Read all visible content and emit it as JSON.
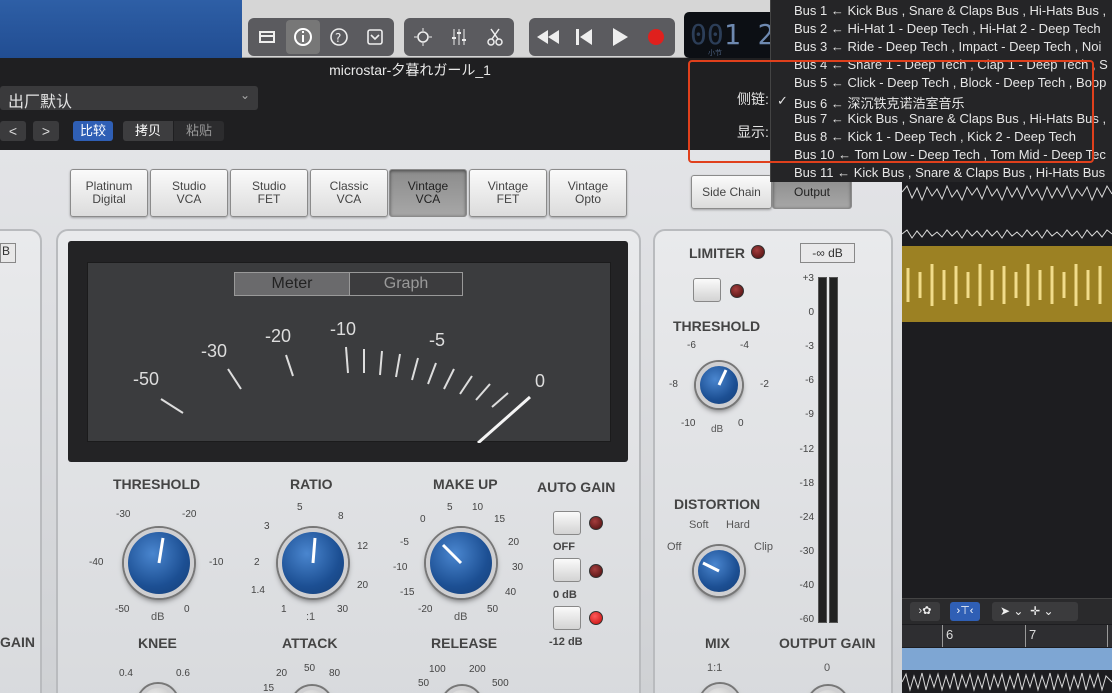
{
  "window": {
    "title": "microstar-夕暮れガール_1"
  },
  "header": {
    "preset": "出厂默认",
    "compare": "比较",
    "copy": "拷贝",
    "paste": "粘贴",
    "prev": "<",
    "next": ">",
    "sidechain_label": "侧链:",
    "view_label": "显示:"
  },
  "timecode": {
    "digits_a": "00",
    "digits_b": "1",
    "digits_c": "2",
    "small": "小节"
  },
  "models": [
    {
      "label": "Platinum\nDigital",
      "selected": false
    },
    {
      "label": "Studio\nVCA",
      "selected": false
    },
    {
      "label": "Studio\nFET",
      "selected": false
    },
    {
      "label": "Classic\nVCA",
      "selected": false
    },
    {
      "label": "Vintage\nVCA",
      "selected": true
    },
    {
      "label": "Vintage\nFET",
      "selected": false
    },
    {
      "label": "Vintage\nOpto",
      "selected": false
    }
  ],
  "side_tabs": {
    "side_chain": "Side Chain",
    "output": "Output"
  },
  "meter": {
    "tab_meter": "Meter",
    "tab_graph": "Graph",
    "scale": [
      "-50",
      "-30",
      "-20",
      "-10",
      "-5",
      "0"
    ]
  },
  "threshold": {
    "label": "THRESHOLD",
    "ticks": [
      "-30",
      "-20",
      "-40",
      "-10",
      "-50",
      "0"
    ],
    "unit": "dB"
  },
  "ratio": {
    "label": "RATIO",
    "ticks": [
      "5",
      "3",
      "8",
      "2",
      "12",
      "1.4",
      "20",
      "1",
      "30"
    ],
    "unit": ":1"
  },
  "makeup": {
    "label": "MAKE UP",
    "ticks": [
      "0",
      "5",
      "10",
      "-5",
      "15",
      "-10",
      "20",
      "-15",
      "30",
      "40",
      "-20",
      "50"
    ],
    "unit": "dB"
  },
  "autogain": {
    "label": "AUTO GAIN",
    "off": "OFF",
    "zero": "0 dB",
    "minus12": "-12 dB"
  },
  "lower": {
    "knee": "KNEE",
    "knee_ticks": [
      "0.4",
      "0.6"
    ],
    "attack": "ATTACK",
    "attack_ticks": [
      "20",
      "50",
      "80",
      "15"
    ],
    "release": "RELEASE",
    "release_ticks": [
      "100",
      "200",
      "50",
      "500"
    ],
    "gain": "GAIN",
    "mix": "MIX",
    "mix_ratio": "1:1",
    "output_gain": "OUTPUT GAIN",
    "output_tick": "0"
  },
  "limiter": {
    "label": "LIMITER",
    "threshold_label": "THRESHOLD",
    "ticks": [
      "-6",
      "-4",
      "-8",
      "-2",
      "-10",
      "0"
    ],
    "unit": "dB"
  },
  "distortion": {
    "label": "DISTORTION",
    "soft": "Soft",
    "hard": "Hard",
    "off": "Off",
    "clip": "Clip"
  },
  "output_meter": {
    "readout": "-∞ dB",
    "scale": [
      "+3",
      "0",
      "-3",
      "-6",
      "-9",
      "-12",
      "-18",
      "-24",
      "-30",
      "-40",
      "-60"
    ]
  },
  "left_meter": {
    "readout": "B"
  },
  "timeline": {
    "marks": [
      "6",
      "7"
    ]
  },
  "sidechain_menu": {
    "items": [
      {
        "label": "Bus 1 ← Kick Bus , Snare & Claps Bus , Hi-Hats Bus ,",
        "checked": false
      },
      {
        "label": "Bus 2 ← Hi-Hat 1 - Deep Tech , Hi-Hat 2 - Deep Tech",
        "checked": false
      },
      {
        "label": "Bus 3 ← Ride - Deep Tech , Impact - Deep Tech , Noi",
        "checked": false
      },
      {
        "label": "Bus 4 ← Snare 1 - Deep Tech , Clap 1 - Deep Tech , S",
        "checked": false
      },
      {
        "label": "Bus 5 ← Click - Deep Tech , Block - Deep Tech , Boop",
        "checked": false
      },
      {
        "label": "Bus 6 ← 深沉铁克诺浩室音乐",
        "checked": true
      },
      {
        "label": "Bus 7 ← Kick Bus , Snare & Claps Bus , Hi-Hats Bus ,",
        "checked": false
      },
      {
        "label": "Bus 8 ← Kick 1 - Deep Tech , Kick 2 - Deep Tech",
        "checked": false
      },
      {
        "label": "Bus 10 ← Tom Low - Deep Tech , Tom Mid - Deep Tec",
        "checked": false
      },
      {
        "label": "Bus 11 ← Kick Bus , Snare & Claps Bus , Hi-Hats Bus",
        "checked": false
      }
    ],
    "checkmark": "✓"
  }
}
